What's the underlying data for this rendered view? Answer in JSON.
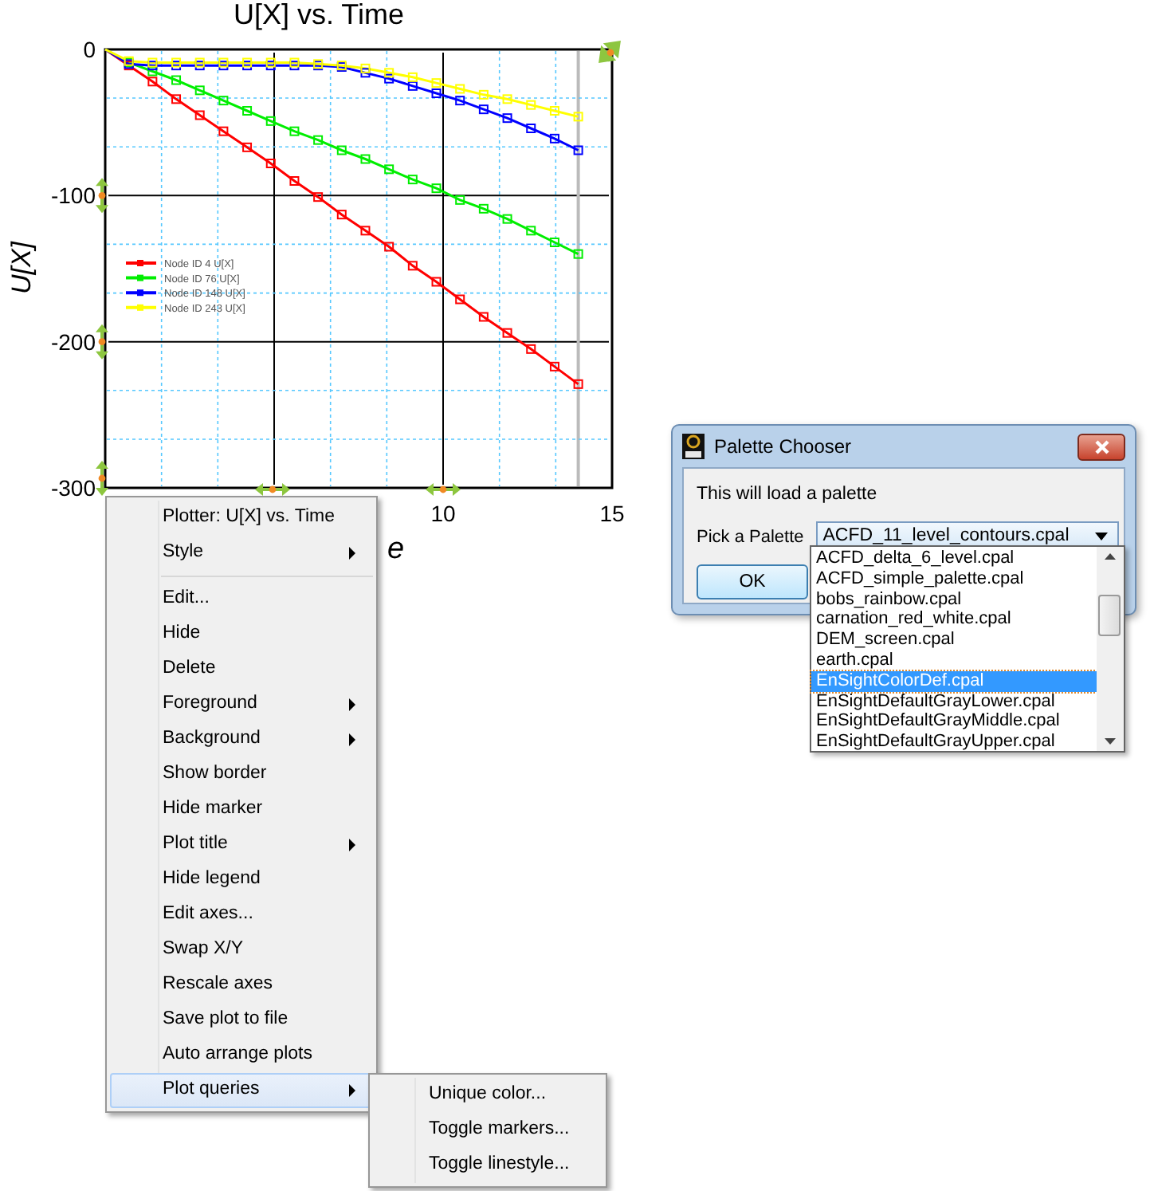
{
  "plot": {
    "chart_data": {
      "type": "line",
      "title": "U[X] vs. Time",
      "xlabel": "e",
      "ylabel": "U[X]",
      "x": [
        0,
        0.7,
        1.4,
        2.1,
        2.8,
        3.5,
        4.2,
        4.9,
        5.6,
        6.3,
        7,
        7.7,
        8.4,
        9.1,
        9.8,
        10.5,
        11.2,
        11.9,
        12.6,
        13.3,
        14
      ],
      "series": [
        {
          "name": "Node ID 4 U[X]",
          "color": "#ff0000",
          "marker": "square",
          "values": [
            0,
            -11,
            -22,
            -34,
            -45,
            -56,
            -67,
            -78,
            -90,
            -101,
            -113,
            -124,
            -135,
            -148,
            -159,
            -171,
            -183,
            -194,
            -205,
            -217,
            -229
          ]
        },
        {
          "name": "Node ID 76 U[X]",
          "color": "#00ee00",
          "marker": "square",
          "values": [
            0,
            -9,
            -15,
            -21,
            -28,
            -35,
            -42,
            -49,
            -56,
            -62,
            -69,
            -75,
            -82,
            -89,
            -95,
            -103,
            -109,
            -116,
            -124,
            -132,
            -140
          ]
        },
        {
          "name": "Node ID 148 U[X]",
          "color": "#0000ff",
          "marker": "square",
          "values": [
            0,
            -10,
            -11,
            -11,
            -11,
            -11,
            -11,
            -11,
            -11,
            -11,
            -12,
            -16,
            -20,
            -25,
            -30,
            -35,
            -41,
            -47,
            -54,
            -61,
            -69
          ]
        },
        {
          "name": "Node ID 243 U[X]",
          "color": "#ffff00",
          "marker": "square",
          "values": [
            0,
            -8,
            -9,
            -9,
            -9,
            -9,
            -9,
            -9,
            -9,
            -10,
            -11,
            -13,
            -16,
            -19,
            -23,
            -27,
            -31,
            -34,
            -38,
            -42,
            -46
          ]
        }
      ],
      "grid": true,
      "legend": true,
      "ref_lines": [
        {
          "axis": "x",
          "value": 14
        },
        {
          "axis": "x",
          "value": 1.667
        },
        {
          "axis": "x",
          "value": 3.333
        },
        {
          "axis": "x",
          "value": 6.667
        },
        {
          "axis": "x",
          "value": 8.333
        },
        {
          "axis": "x",
          "value": 11.667
        },
        {
          "axis": "x",
          "value": 13.333
        },
        {
          "axis": "y",
          "value": -33.3
        },
        {
          "axis": "y",
          "value": -66.7
        },
        {
          "axis": "y",
          "value": -133.3
        },
        {
          "axis": "y",
          "value": -166.7
        },
        {
          "axis": "y",
          "value": -233.3
        },
        {
          "axis": "y",
          "value": -266.7
        }
      ],
      "xlim": [
        0,
        15
      ],
      "ylim": [
        -300,
        0
      ],
      "xticks": [
        10,
        15
      ],
      "yticks": [
        0,
        -100,
        -200,
        -300
      ]
    }
  },
  "context_menu": {
    "items": [
      {
        "kind": "header",
        "label": "Plotter: U[X] vs. Time",
        "selected": false
      },
      {
        "kind": "submenu",
        "label": "Style",
        "selected": false
      },
      {
        "kind": "separator"
      },
      {
        "kind": "item",
        "label": "Edit...",
        "selected": false
      },
      {
        "kind": "item",
        "label": "Hide",
        "selected": false
      },
      {
        "kind": "item",
        "label": "Delete",
        "selected": false
      },
      {
        "kind": "submenu",
        "label": "Foreground",
        "selected": false
      },
      {
        "kind": "submenu",
        "label": "Background",
        "selected": false
      },
      {
        "kind": "item",
        "label": "Show border",
        "selected": false
      },
      {
        "kind": "item",
        "label": "Hide marker",
        "selected": false
      },
      {
        "kind": "submenu",
        "label": "Plot title",
        "selected": false
      },
      {
        "kind": "item",
        "label": "Hide legend",
        "selected": false
      },
      {
        "kind": "item",
        "label": "Edit axes...",
        "selected": false
      },
      {
        "kind": "item",
        "label": "Swap X/Y",
        "selected": false
      },
      {
        "kind": "item",
        "label": "Rescale axes",
        "selected": false
      },
      {
        "kind": "item",
        "label": "Save plot to file",
        "selected": false
      },
      {
        "kind": "item",
        "label": "Auto arrange plots",
        "selected": false
      },
      {
        "kind": "submenu",
        "label": "Plot queries",
        "selected": true
      }
    ]
  },
  "submenu": {
    "items": [
      {
        "label": "Unique color...",
        "selected": false
      },
      {
        "label": "Toggle markers...",
        "selected": false
      },
      {
        "label": "Toggle linestyle...",
        "selected": false
      }
    ]
  },
  "dialog": {
    "title": "Palette Chooser",
    "message": "This will load a palette",
    "field_label": "Pick a Palette",
    "value": "ACFD_11_level_contours.cpal",
    "button": "OK",
    "options": [
      {
        "label": "ACFD_delta_6_level.cpal",
        "selected": false
      },
      {
        "label": "ACFD_simple_palette.cpal",
        "selected": false
      },
      {
        "label": "bobs_rainbow.cpal",
        "selected": false
      },
      {
        "label": "carnation_red_white.cpal",
        "selected": false
      },
      {
        "label": "DEM_screen.cpal",
        "selected": false
      },
      {
        "label": "earth.cpal",
        "selected": false
      },
      {
        "label": "EnSightColorDef.cpal",
        "selected": true
      },
      {
        "label": "EnSightDefaultGrayLower.cpal",
        "selected": false
      },
      {
        "label": "EnSightDefaultGrayMiddle.cpal",
        "selected": false
      },
      {
        "label": "EnSightDefaultGrayUpper.cpal",
        "selected": false
      }
    ]
  }
}
